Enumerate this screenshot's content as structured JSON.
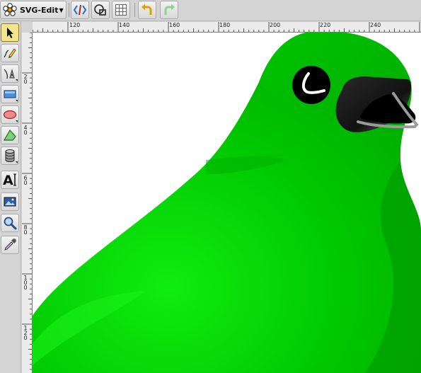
{
  "app": {
    "title": "SVG-Edit"
  },
  "toolbar": {
    "menu_caret": "▼",
    "buttons": [
      "source-editor",
      "group-view",
      "grid",
      "undo",
      "redo"
    ]
  },
  "tools": [
    "select",
    "pencil",
    "path",
    "rectangle",
    "ellipse",
    "polygon",
    "shape-library",
    "text",
    "image",
    "zoom",
    "eyedropper"
  ],
  "text_tool_label": "A",
  "rulers": {
    "top_labels": [
      "120",
      "140",
      "160",
      "180",
      "200",
      "220",
      "240"
    ],
    "left_labels": [
      "20",
      "40",
      "60",
      "80",
      "100",
      "120"
    ]
  },
  "colors": {
    "bird_body": "#00c400",
    "bird_shadow": "#009a00",
    "beak": "#1a1a1a",
    "eye": "#000000",
    "selected_tool": "#f2e58a"
  }
}
